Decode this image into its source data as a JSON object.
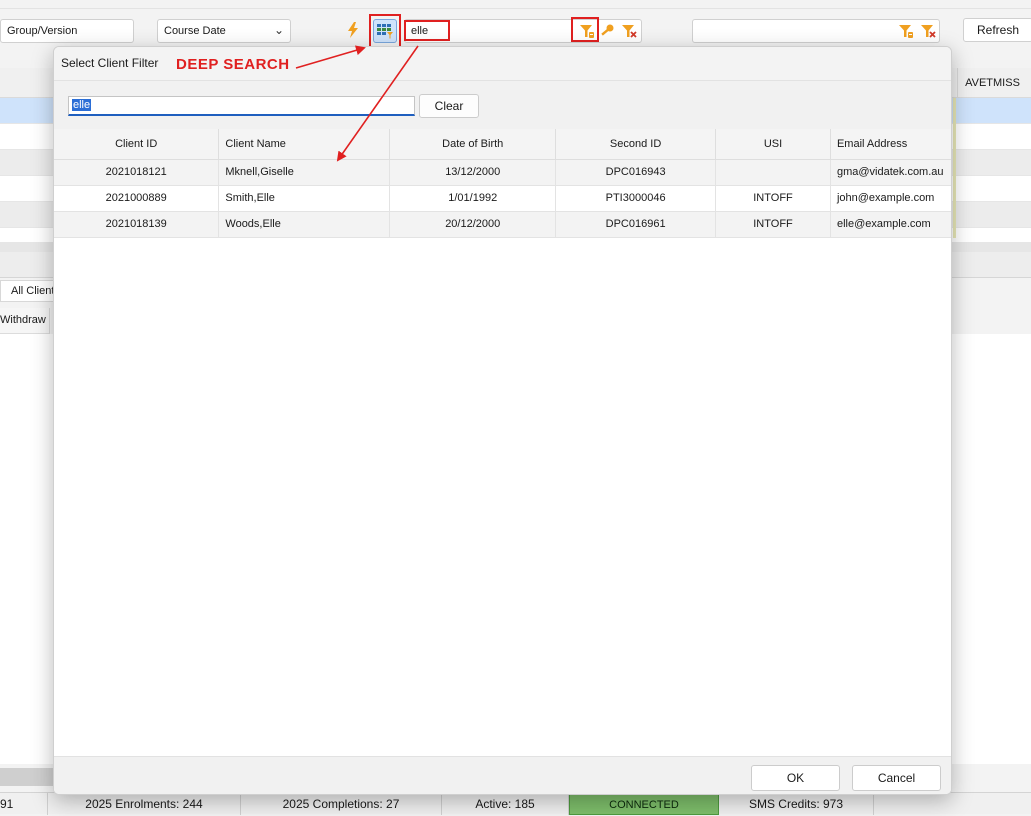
{
  "toolbar": {
    "group_version": "Group/Version",
    "course_date": "Course Date",
    "search_value": "elle",
    "refresh_label": "Refresh"
  },
  "background": {
    "column_avetmiss": "AVETMISS",
    "tab_all_clients": "All Clients",
    "column_withdraw": "Withdraw",
    "status_prefix": "91",
    "status_enrolments": "2025 Enrolments: 244",
    "status_completions": "2025 Completions: 27",
    "status_active": "Active: 185",
    "status_connected": "CONNECTED",
    "status_sms": "SMS Credits: 973"
  },
  "annotation": {
    "deep_search_label": "DEEP SEARCH"
  },
  "dialog": {
    "title": "Select Client Filter",
    "search_value": "elle",
    "clear_label": "Clear",
    "columns": [
      "Client ID",
      "Client Name",
      "Date of Birth",
      "Second ID",
      "USI",
      "Email Address"
    ],
    "rows": [
      {
        "client_id": "2021018121",
        "client_name": "Mknell,Giselle",
        "dob": "13/12/2000",
        "second_id": "DPC016943",
        "usi": "",
        "email": "gma@vidatek.com.au"
      },
      {
        "client_id": "2021000889",
        "client_name": "Smith,Elle",
        "dob": "1/01/1992",
        "second_id": "PTI3000046",
        "usi": "INTOFF",
        "email": "john@example.com"
      },
      {
        "client_id": "2021018139",
        "client_name": "Woods,Elle",
        "dob": "20/12/2000",
        "second_id": "DPC016961",
        "usi": "INTOFF",
        "email": "elle@example.com"
      }
    ],
    "ok_label": "OK",
    "cancel_label": "Cancel"
  },
  "colors": {
    "annotation_red": "#e02020",
    "filter_orange": "#f0a020",
    "selection_blue": "#2b6ed6",
    "connected_green": "#7dbd6a",
    "row_highlight": "#cfe3fb"
  }
}
